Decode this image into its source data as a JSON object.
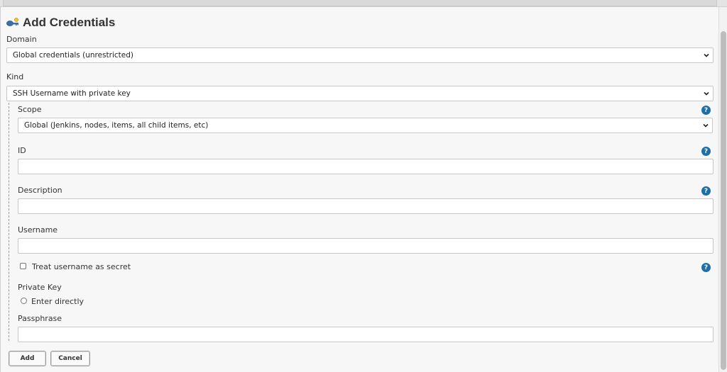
{
  "dialog": {
    "title": "Add Credentials",
    "icon": "credentials-key-icon"
  },
  "domain": {
    "label": "Domain",
    "selected": "Global credentials (unrestricted)"
  },
  "kind": {
    "label": "Kind",
    "selected": "SSH Username with private key"
  },
  "scope": {
    "label": "Scope",
    "selected": "Global (Jenkins, nodes, items, all child items, etc)"
  },
  "id_field": {
    "label": "ID",
    "value": ""
  },
  "description_field": {
    "label": "Description",
    "value": ""
  },
  "username_field": {
    "label": "Username",
    "value": ""
  },
  "secret_checkbox": {
    "label": "Treat username as secret",
    "checked": false
  },
  "private_key": {
    "label": "Private Key",
    "option_label": "Enter directly",
    "selected": false
  },
  "passphrase_field": {
    "label": "Passphrase",
    "value": ""
  },
  "help": {
    "glyph": "?"
  },
  "buttons": {
    "add": "Add",
    "cancel": "Cancel"
  },
  "colors": {
    "help_icon": "#1f6fa7",
    "panel_background": "#f7f7f7"
  }
}
